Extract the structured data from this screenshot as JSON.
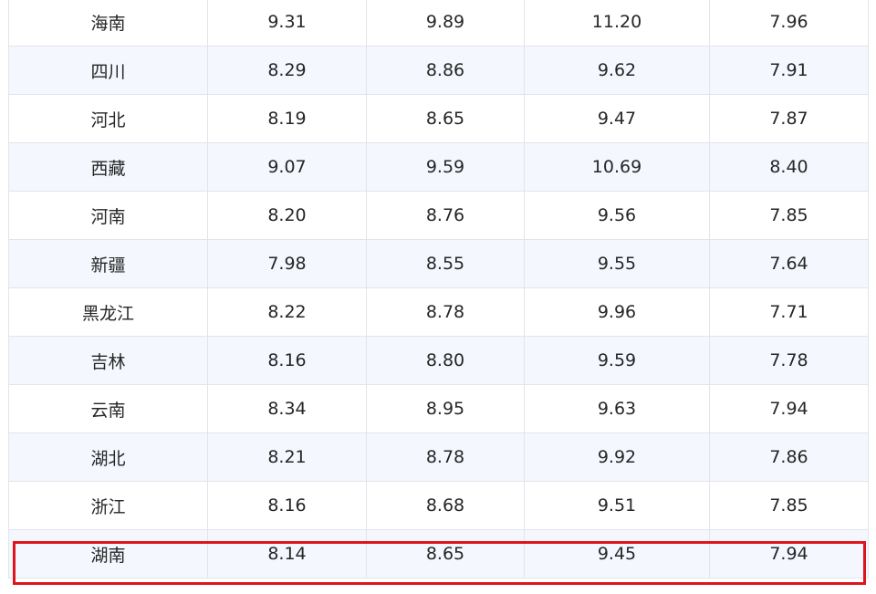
{
  "table": {
    "rows": [
      {
        "province": "海南",
        "v1": "9.31",
        "v2": "9.89",
        "v3": "11.20",
        "v4": "7.96"
      },
      {
        "province": "四川",
        "v1": "8.29",
        "v2": "8.86",
        "v3": "9.62",
        "v4": "7.91"
      },
      {
        "province": "河北",
        "v1": "8.19",
        "v2": "8.65",
        "v3": "9.47",
        "v4": "7.87"
      },
      {
        "province": "西藏",
        "v1": "9.07",
        "v2": "9.59",
        "v3": "10.69",
        "v4": "8.40"
      },
      {
        "province": "河南",
        "v1": "8.20",
        "v2": "8.76",
        "v3": "9.56",
        "v4": "7.85"
      },
      {
        "province": "新疆",
        "v1": "7.98",
        "v2": "8.55",
        "v3": "9.55",
        "v4": "7.64"
      },
      {
        "province": "黑龙江",
        "v1": "8.22",
        "v2": "8.78",
        "v3": "9.96",
        "v4": "7.71"
      },
      {
        "province": "吉林",
        "v1": "8.16",
        "v2": "8.80",
        "v3": "9.59",
        "v4": "7.78"
      },
      {
        "province": "云南",
        "v1": "8.34",
        "v2": "8.95",
        "v3": "9.63",
        "v4": "7.94"
      },
      {
        "province": "湖北",
        "v1": "8.21",
        "v2": "8.78",
        "v3": "9.92",
        "v4": "7.86"
      },
      {
        "province": "浙江",
        "v1": "8.16",
        "v2": "8.68",
        "v3": "9.51",
        "v4": "7.85"
      },
      {
        "province": "湖南",
        "v1": "8.14",
        "v2": "8.65",
        "v3": "9.45",
        "v4": "7.94"
      }
    ]
  },
  "colors": {
    "highlight_border": "#e0151b",
    "row_stripe": "#f4f8fe",
    "grid_line": "#e2e4ea"
  }
}
